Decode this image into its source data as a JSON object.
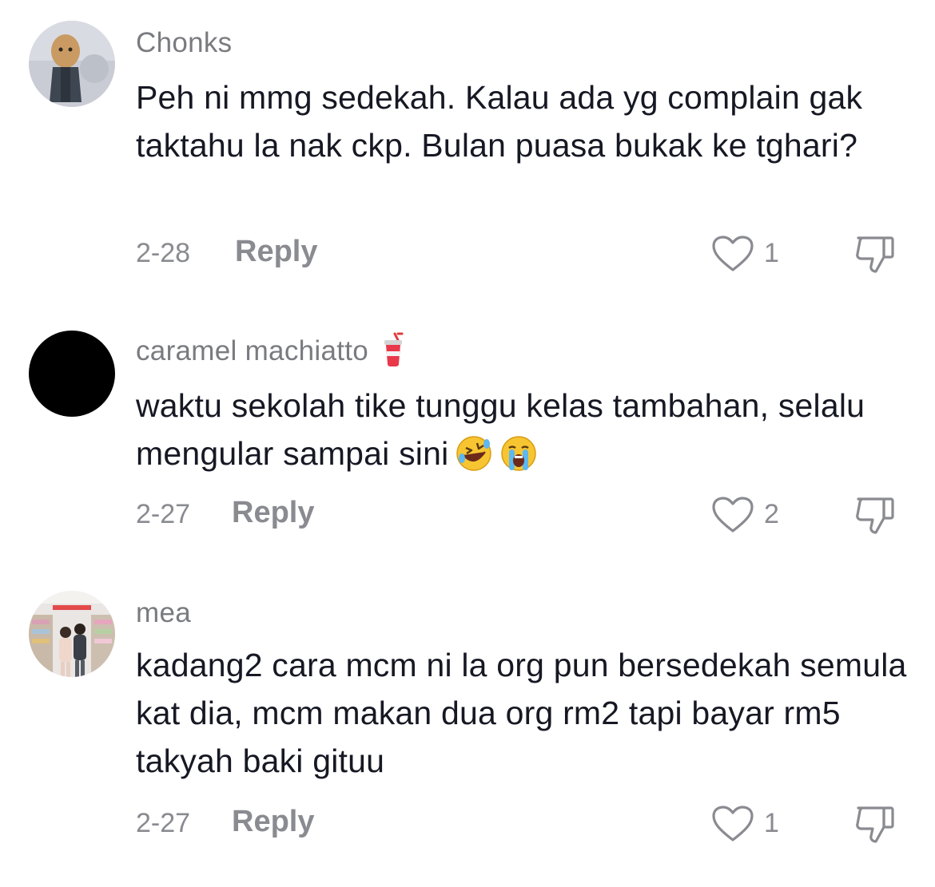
{
  "comments": [
    {
      "username": "Chonks",
      "text": "Peh ni mmg sedekah. Kalau ada yg complain gak taktahu la nak ckp. Bulan puasa bukak ke tghari?",
      "date": "2-28",
      "reply_label": "Reply",
      "likes": "1",
      "avatar": "plush-toy-avatar"
    },
    {
      "username": "caramel machiatto",
      "username_badge": "cup-with-straw-emoji",
      "text": "waktu sekolah tike tunggu kelas tambahan, selalu mengular sampai sini",
      "emojis": [
        "rolling-on-floor-laughing-emoji",
        "loudly-crying-emoji"
      ],
      "date": "2-27",
      "reply_label": "Reply",
      "likes": "2",
      "avatar": "black-circle-avatar"
    },
    {
      "username": "mea",
      "text": "kadang2 cara mcm ni la org pun bersedekah semula kat dia, mcm makan dua org rm2 tapi bayar rm5 takyah baki gituu",
      "date": "2-27",
      "reply_label": "Reply",
      "likes": "1",
      "avatar": "couple-photo-avatar"
    }
  ],
  "icons": {
    "like": "heart-outline-icon",
    "dislike": "thumbs-down-icon"
  },
  "colors": {
    "text": "#161823",
    "muted": "#8a8b91",
    "background": "#ffffff"
  }
}
